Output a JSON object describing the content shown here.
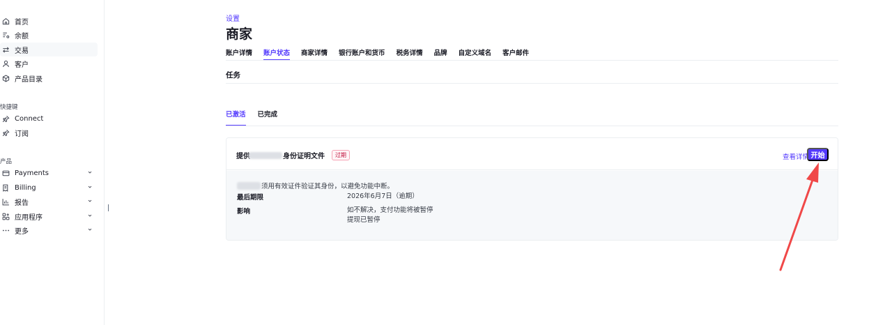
{
  "sidebar": {
    "items": [
      {
        "label": "首页",
        "icon": "home-icon"
      },
      {
        "label": "余额",
        "icon": "balance-icon"
      },
      {
        "label": "交易",
        "icon": "transactions-icon"
      },
      {
        "label": "客户",
        "icon": "customer-icon"
      },
      {
        "label": "产品目录",
        "icon": "product-catalog-icon"
      }
    ],
    "shortcuts_label": "快捷键",
    "shortcuts": [
      {
        "label": "Connect",
        "icon": "pin-icon"
      },
      {
        "label": "订阅",
        "icon": "pin-icon"
      }
    ],
    "products_label": "产品",
    "products": [
      {
        "label": "Payments",
        "icon": "payments-icon"
      },
      {
        "label": "Billing",
        "icon": "billing-icon"
      },
      {
        "label": "报告",
        "icon": "reports-icon"
      },
      {
        "label": "应用程序",
        "icon": "apps-icon"
      },
      {
        "label": "更多",
        "icon": "more-icon"
      }
    ]
  },
  "header": {
    "breadcrumb": "设置",
    "title": "商家"
  },
  "tabs": [
    "账户详情",
    "账户状态",
    "商家详情",
    "银行账户和货币",
    "税务详情",
    "品牌",
    "自定义域名",
    "客户邮件"
  ],
  "tasks": {
    "section_title": "任务",
    "subtabs": [
      "已激活",
      "已完成"
    ],
    "card": {
      "title_prefix": "提供",
      "title_suffix": "身份证明文件",
      "badge": "过期",
      "details_link": "查看详情",
      "start_button": "开始",
      "description": "须用有效证件验证其身份，以避免功能中断。",
      "deadline_label": "最后期限",
      "deadline_value": "2026年6月7日（逾期）",
      "impact_label": "影响",
      "impact_line1": "如不解决，支付功能将被暂停",
      "impact_line2": "提现已暂停"
    }
  },
  "colors": {
    "accent": "#533afd",
    "annotation_arrow": "#f04848",
    "badge_red": "#c0123c"
  }
}
